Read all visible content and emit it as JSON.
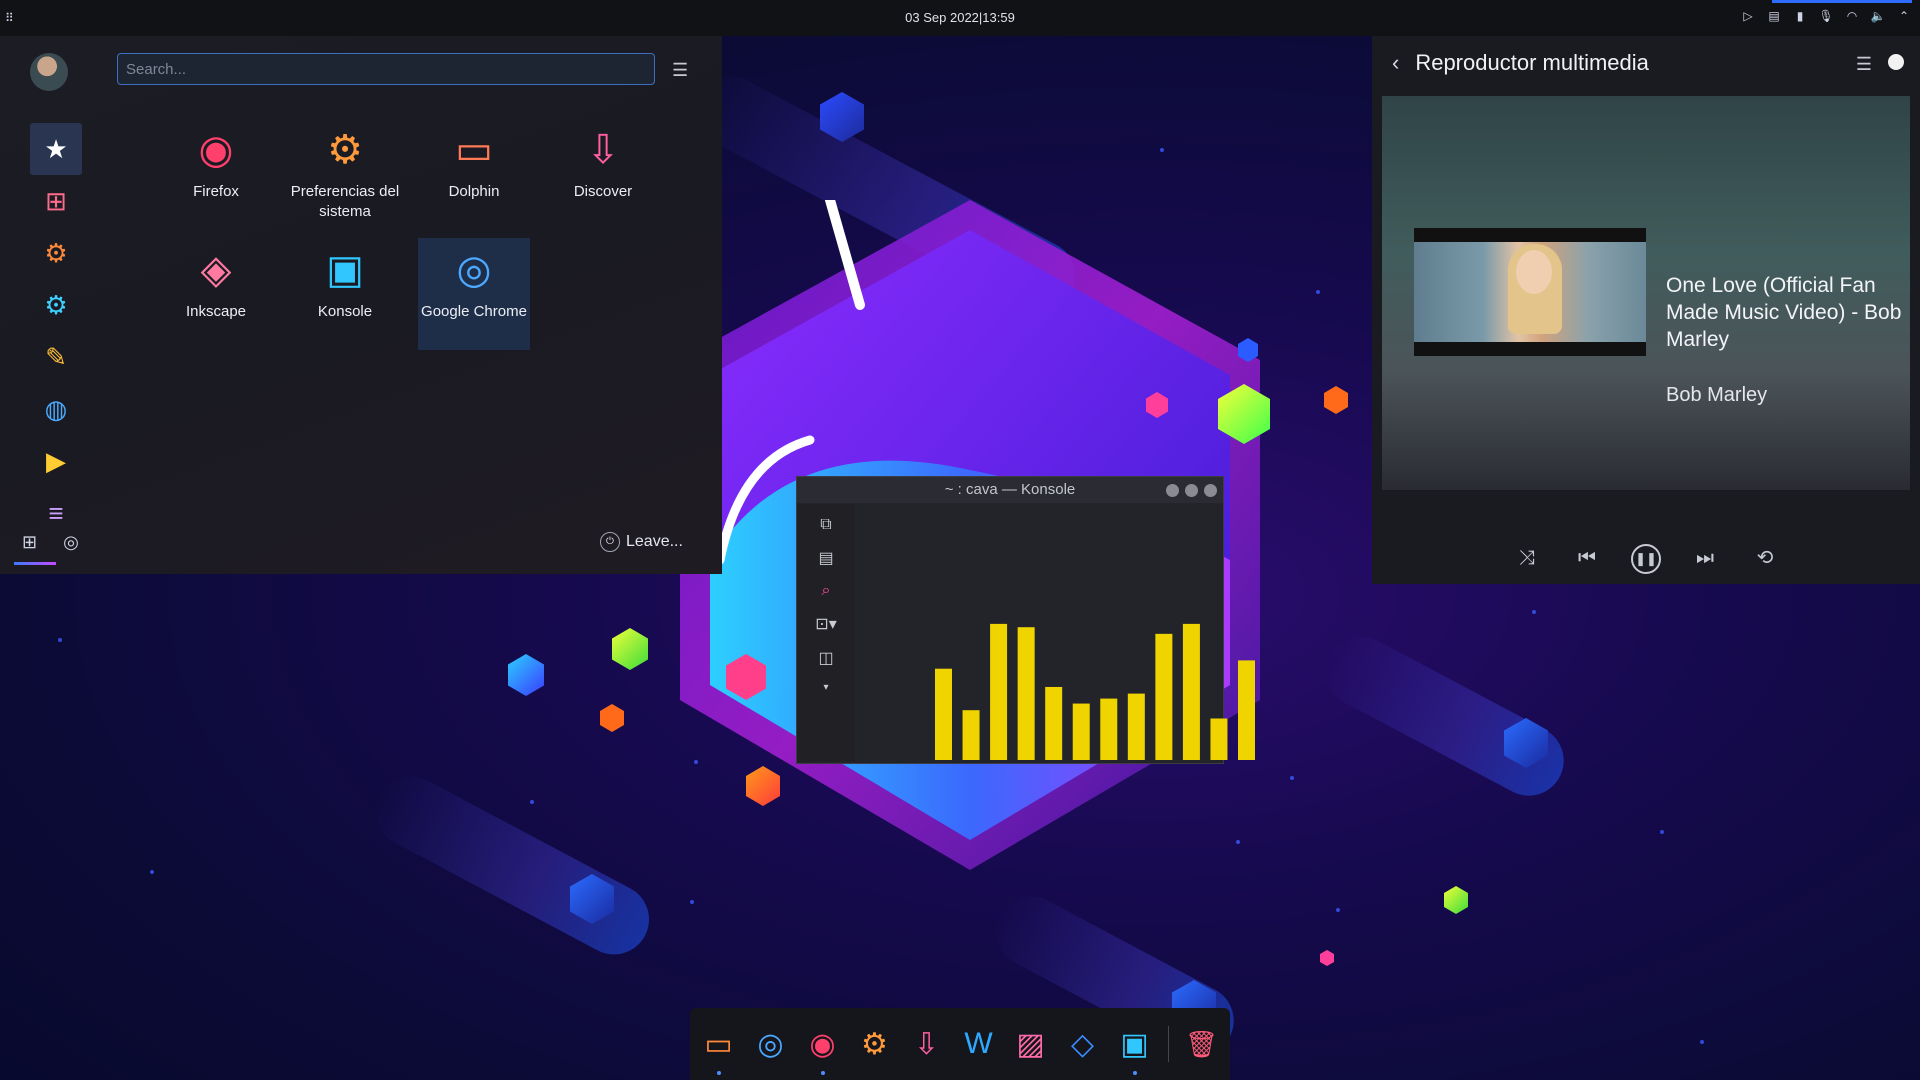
{
  "topbar": {
    "clock": "03 Sep 2022|13:59",
    "tray_icons": [
      "media-play-icon",
      "clipboard-icon",
      "battery-icon",
      "microphone-icon",
      "network-icon",
      "volume-icon",
      "chevron-up-icon"
    ]
  },
  "launcher": {
    "search_placeholder": "Search...",
    "sidebar": [
      {
        "name": "favorites",
        "icon": "star-icon",
        "glyph": "★",
        "active": true
      },
      {
        "name": "all-apps",
        "icon": "grid-icon",
        "glyph": "⊞"
      },
      {
        "name": "settings",
        "icon": "gear-icon",
        "glyph": "⚙"
      },
      {
        "name": "development",
        "icon": "code-gear-icon",
        "glyph": "⚙"
      },
      {
        "name": "graphics",
        "icon": "brush-icon",
        "glyph": "✎"
      },
      {
        "name": "internet",
        "icon": "globe-icon",
        "glyph": "◍"
      },
      {
        "name": "multimedia",
        "icon": "play-icon",
        "glyph": "▶"
      },
      {
        "name": "office",
        "icon": "document-icon",
        "glyph": "≡"
      }
    ],
    "apps": [
      {
        "label": "Firefox",
        "icon": "firefox-icon",
        "glyph": "◉",
        "color": "#ff3f6c"
      },
      {
        "label": "Preferencias del sistema",
        "icon": "settings-icon",
        "glyph": "⚙",
        "color": "#ff9a3c"
      },
      {
        "label": "Dolphin",
        "icon": "folder-icon",
        "glyph": "▭",
        "color": "#ff7a55"
      },
      {
        "label": "Discover",
        "icon": "discover-icon",
        "glyph": "⇩",
        "color": "#ff5fa2"
      },
      {
        "label": "Inkscape",
        "icon": "inkscape-icon",
        "glyph": "◈",
        "color": "#ff7aa0"
      },
      {
        "label": "Konsole",
        "icon": "terminal-icon",
        "glyph": "▣",
        "color": "#32c6ff"
      },
      {
        "label": "Google Chrome",
        "icon": "chrome-icon",
        "glyph": "◎",
        "color": "#4ca8ff",
        "selected": true
      }
    ],
    "leave_label": "Leave..."
  },
  "player": {
    "header_title": "Reproductor multimedia",
    "track_title": "One Love (Official Fan Made Music Video) - Bob Marley",
    "artist": "Bob Marley",
    "controls": [
      {
        "name": "shuffle-button",
        "glyph": "⤨"
      },
      {
        "name": "previous-button",
        "glyph": "⏮"
      },
      {
        "name": "play-pause-button",
        "glyph": "❚❚"
      },
      {
        "name": "next-button",
        "glyph": "⏭"
      },
      {
        "name": "repeat-button",
        "glyph": "⟲"
      }
    ]
  },
  "konsole": {
    "window_title": "~ : cava — Konsole",
    "toolbar_icons": [
      "copy-icon",
      "paste-icon",
      "find-icon",
      "new-tab-icon",
      "split-view-icon",
      "more-icon"
    ],
    "bar_levels": [
      0.55,
      0.3,
      0.82,
      0.8,
      0.44,
      0.34,
      0.37,
      0.4,
      0.76,
      0.82,
      0.25,
      0.6
    ],
    "bar_color": "#f0d400"
  },
  "dock": {
    "items": [
      {
        "name": "dolphin",
        "icon": "folder-icon",
        "glyph": "▭",
        "color": "#ff8a3c",
        "running": true
      },
      {
        "name": "chrome",
        "icon": "chrome-icon",
        "glyph": "◎",
        "color": "#4ca8ff",
        "running": false
      },
      {
        "name": "firefox",
        "icon": "firefox-icon",
        "glyph": "◉",
        "color": "#ff3f6c",
        "running": true
      },
      {
        "name": "settings",
        "icon": "gear-icon",
        "glyph": "⚙",
        "color": "#ff9a3c",
        "running": false
      },
      {
        "name": "discover",
        "icon": "discover-icon",
        "glyph": "⇩",
        "color": "#ff5fa2",
        "running": false
      },
      {
        "name": "writer",
        "icon": "writer-icon",
        "glyph": "W",
        "color": "#2fa8ff",
        "running": false
      },
      {
        "name": "image-viewer",
        "icon": "image-icon",
        "glyph": "▨",
        "color": "#ff6aa8",
        "running": false
      },
      {
        "name": "vscode",
        "icon": "code-icon",
        "glyph": "◇",
        "color": "#3a8dff",
        "running": false
      },
      {
        "name": "konsole",
        "icon": "terminal-icon",
        "glyph": "▣",
        "color": "#32c6ff",
        "running": true
      }
    ],
    "trash": {
      "name": "trash",
      "icon": "trash-icon",
      "glyph": "🗑",
      "color": "#ff5a7a"
    }
  }
}
